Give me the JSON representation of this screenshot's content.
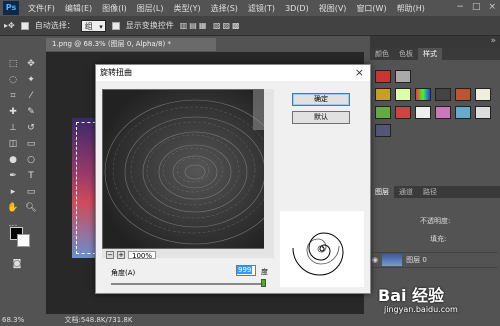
{
  "app": {
    "logo": "Ps"
  },
  "menu": [
    "文件(F)",
    "编辑(E)",
    "图像(I)",
    "图层(L)",
    "类型(Y)",
    "选择(S)",
    "滤镜(T)",
    "3D(D)",
    "视图(V)",
    "窗口(W)",
    "帮助(H)"
  ],
  "options": {
    "auto_select_label": "自动选择：",
    "auto_select_value": "组",
    "show_transform_label": "显示变换控件"
  },
  "document": {
    "tab_title": "1.png @ 68.3% (图层 0, Alpha/8) *",
    "zoom": "68.3%",
    "doc_info": "文档:548.8K/731.8K"
  },
  "right_panel": {
    "tabs": [
      "颜色",
      "色板",
      "样式"
    ],
    "active_tab": "样式",
    "layers_tabs": [
      "图层",
      "通道",
      "路径"
    ],
    "opacity_label": "不透明度:",
    "fill_label": "填充:",
    "layer_name": "图层 0"
  },
  "dialog": {
    "title": "旋转扭曲",
    "close": "×",
    "ok_label": "确定",
    "reset_label": "默认",
    "zoom_level": "100%",
    "zoom_minus": "−",
    "zoom_plus": "+",
    "angle_label": "角度(A)",
    "angle_value": "999",
    "angle_unit": "度"
  },
  "watermark": {
    "text": "Bai 经验",
    "url": "jingyan.baidu.com"
  },
  "colors": {
    "foreground": "#000000",
    "background": "#ffffff",
    "accent": "#3399ff"
  }
}
